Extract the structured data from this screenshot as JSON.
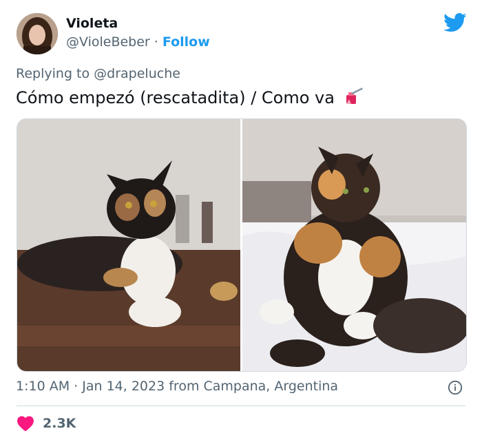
{
  "author": {
    "name": "Violeta",
    "handle": "@VioleBeber",
    "separator": "·",
    "follow_label": "Follow"
  },
  "reply": {
    "prefix": "Replying to",
    "mention": "@drapeluche"
  },
  "tweet": {
    "text": "Cómo empezó (rescatadita) / Como va",
    "emoji": "nail-polish-emoji"
  },
  "meta": {
    "time": "1:10 AM",
    "separator": "·",
    "date": "Jan 14, 2023",
    "from_label": "from",
    "location": "Campana, Argentina"
  },
  "engagement": {
    "likes": "2.3K"
  },
  "colors": {
    "accent": "#1d9bf0",
    "heart": "#f91880",
    "secondary_text": "#536471"
  },
  "icons": [
    "twitter-bird-icon",
    "info-icon",
    "heart-icon"
  ]
}
